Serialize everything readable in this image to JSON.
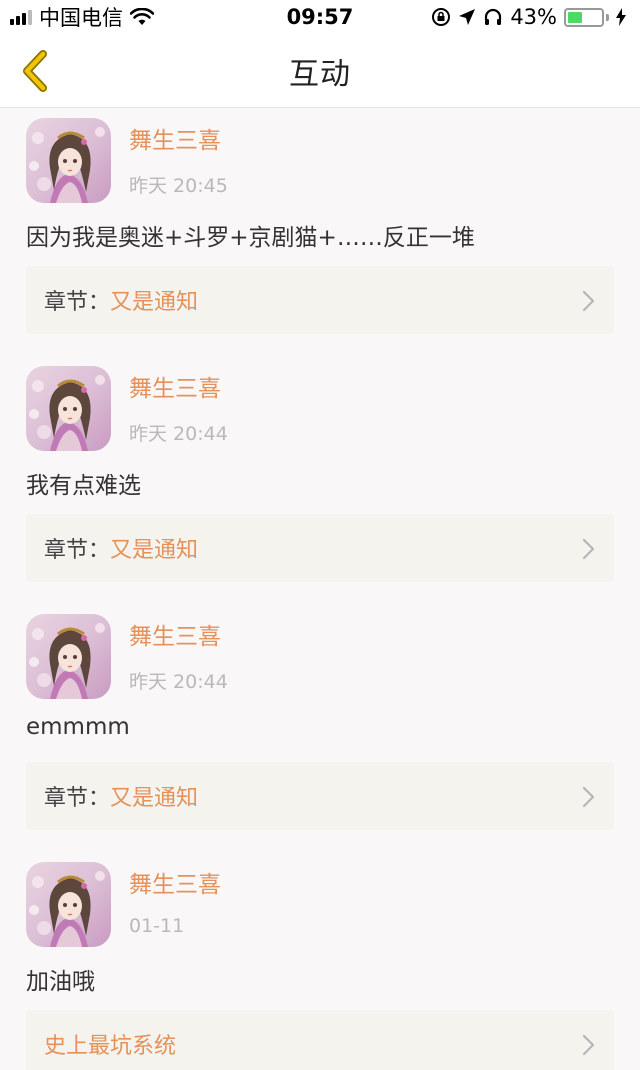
{
  "status_bar": {
    "carrier": "中国电信",
    "time": "09:57",
    "battery_percent": "43%",
    "battery_level": 0.43,
    "icons": [
      "signal-icon",
      "wifi-icon",
      "orientation-lock-icon",
      "location-arrow-icon",
      "headphones-icon",
      "battery-icon",
      "charging-bolt-icon"
    ]
  },
  "nav": {
    "title": "互动",
    "back_icon": "chevron-left-icon"
  },
  "colors": {
    "accent": "#e6915a",
    "back_chevron": "#f2c500",
    "card_bg": "#f4f3ee",
    "page_bg": "#f9f7f8"
  },
  "items": [
    {
      "name": "舞生三喜",
      "time": "昨天 20:45",
      "content": "因为我是奥迷+斗罗+京剧猫+……反正一堆",
      "chapter_label": "章节：",
      "chapter_title": "又是通知"
    },
    {
      "name": "舞生三喜",
      "time": "昨天 20:44",
      "content": "我有点难选",
      "chapter_label": "章节：",
      "chapter_title": "又是通知"
    },
    {
      "name": "舞生三喜",
      "time": "昨天 20:44",
      "content": "emmmm",
      "chapter_label": "章节：",
      "chapter_title": "又是通知"
    },
    {
      "name": "舞生三喜",
      "time": "01-11",
      "content": "加油哦",
      "chapter_label": "",
      "chapter_title": "史上最坑系统"
    }
  ]
}
